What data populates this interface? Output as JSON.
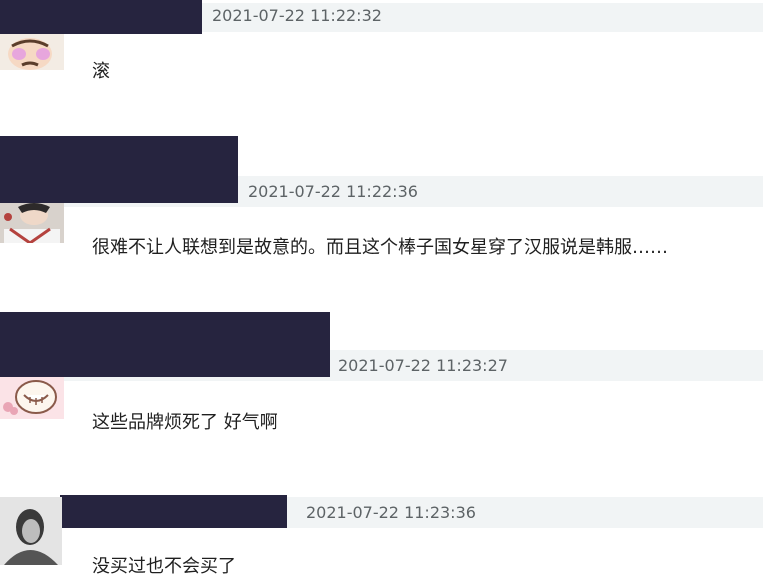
{
  "comments": [
    {
      "timestamp": "2021-07-22 11:22:32",
      "text": "滚"
    },
    {
      "timestamp": "2021-07-22 11:22:36",
      "text": "很难不让人联想到是故意的。而且这个棒子国女星穿了汉服说是韩服……"
    },
    {
      "timestamp": "2021-07-22 11:23:27",
      "text": "这些品牌烦死了 好气啊"
    },
    {
      "timestamp": "2021-07-22 11:23:36",
      "text": "没买过也不会买了"
    }
  ],
  "colors": {
    "redaction": "#26243f",
    "header_bg": "#f1f4f5",
    "timestamp": "#5d6366",
    "text": "#1f1f1f"
  }
}
